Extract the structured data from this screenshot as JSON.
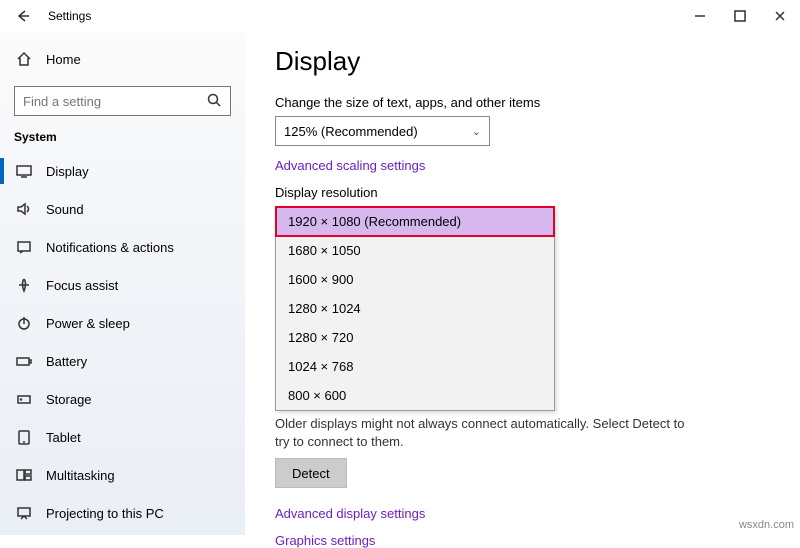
{
  "window": {
    "title": "Settings"
  },
  "sidebar": {
    "home": "Home",
    "search_placeholder": "Find a setting",
    "category": "System",
    "items": [
      {
        "label": "Display",
        "active": true
      },
      {
        "label": "Sound"
      },
      {
        "label": "Notifications & actions"
      },
      {
        "label": "Focus assist"
      },
      {
        "label": "Power & sleep"
      },
      {
        "label": "Battery"
      },
      {
        "label": "Storage"
      },
      {
        "label": "Tablet"
      },
      {
        "label": "Multitasking"
      },
      {
        "label": "Projecting to this PC"
      }
    ]
  },
  "main": {
    "heading": "Display",
    "scale_label": "Change the size of text, apps, and other items",
    "scale_value": "125% (Recommended)",
    "adv_scaling": "Advanced scaling settings",
    "res_label": "Display resolution",
    "res_options": [
      "1920 × 1080 (Recommended)",
      "1680 × 1050",
      "1600 × 900",
      "1280 × 1024",
      "1280 × 720",
      "1024 × 768",
      "800 × 600"
    ],
    "note": "Older displays might not always connect automatically. Select Detect to try to connect to them.",
    "detect": "Detect",
    "adv_display": "Advanced display settings",
    "graphics": "Graphics settings"
  },
  "watermark": "wsxdn.com"
}
